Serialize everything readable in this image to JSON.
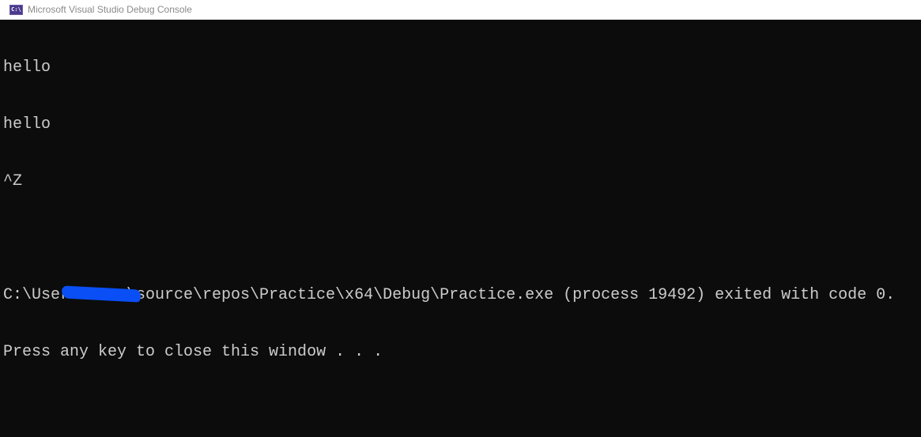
{
  "window": {
    "title": "Microsoft Visual Studio Debug Console",
    "icon": "console-app-icon",
    "icon_text": "C:\\"
  },
  "console": {
    "lines": [
      "hello",
      "hello",
      "^Z",
      ""
    ],
    "path_prefix": "C:\\Users",
    "path_suffix": "\\source\\repos\\Practice\\x64\\Debug\\Practice.exe (process 19492) exited with code 0.",
    "prompt": "Press any key to close this window . . ."
  },
  "colors": {
    "background": "#0c0c0c",
    "text": "#cccccc",
    "redaction": "#0a4ff5"
  }
}
